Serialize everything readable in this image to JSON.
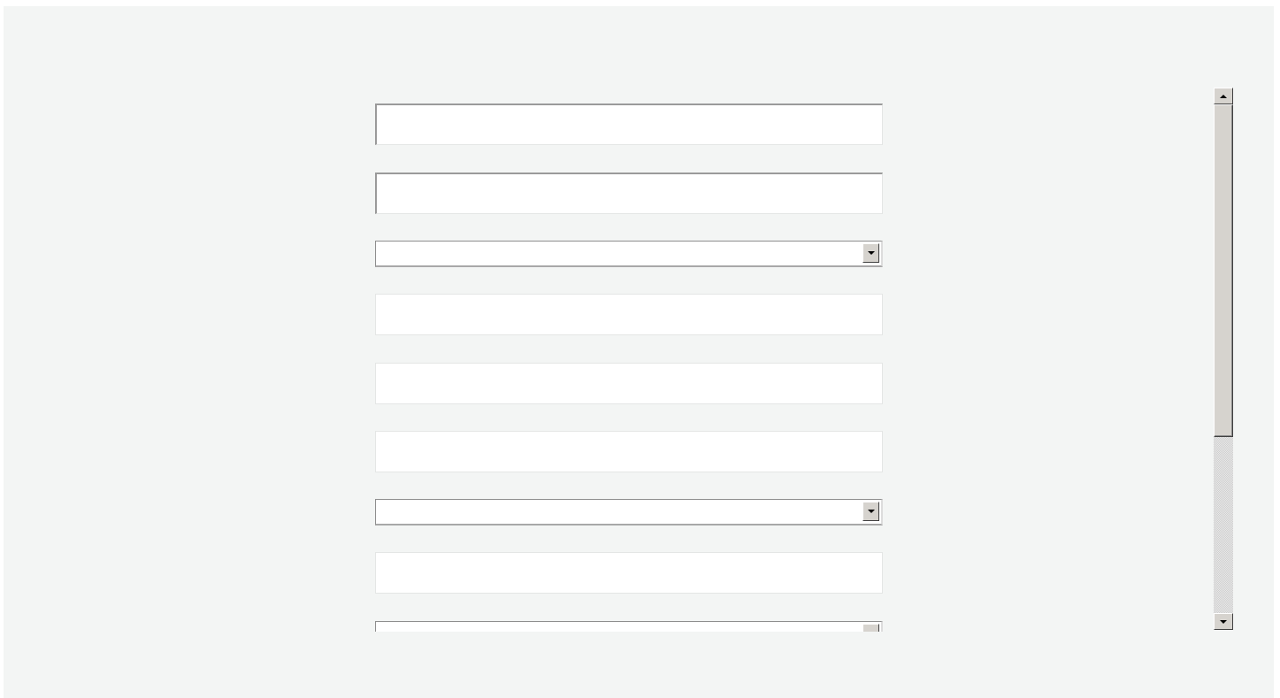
{
  "form": {
    "fields": [
      {
        "type": "text",
        "value": "",
        "placeholder": ""
      },
      {
        "type": "text",
        "value": "",
        "placeholder": ""
      },
      {
        "type": "select",
        "value": ""
      },
      {
        "type": "text",
        "value": "",
        "placeholder": ""
      },
      {
        "type": "text",
        "value": "",
        "placeholder": ""
      },
      {
        "type": "text",
        "value": "",
        "placeholder": ""
      },
      {
        "type": "select",
        "value": ""
      },
      {
        "type": "text",
        "value": "",
        "placeholder": ""
      },
      {
        "type": "select",
        "value": ""
      }
    ]
  },
  "scrollbar": {
    "up_icon": "triangle-up-icon",
    "down_icon": "triangle-down-icon",
    "thumb_fraction": 0.65,
    "scroll_position": 0.0
  },
  "colors": {
    "background": "#f3f5f4",
    "field_background": "#ffffff",
    "scrollbar_face": "#d6d3ce"
  }
}
